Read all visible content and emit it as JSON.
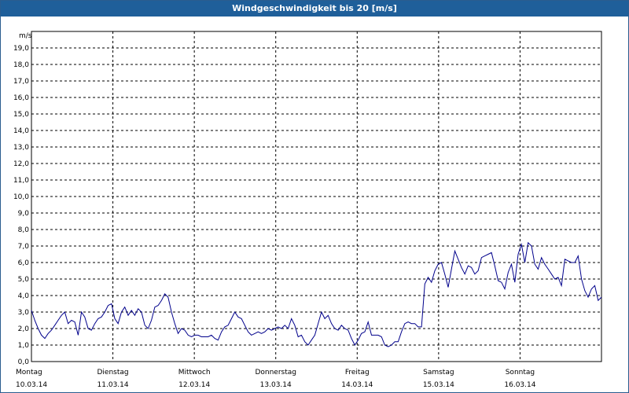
{
  "window": {
    "title": "Windgeschwindigkeit bis 20 [m/s]"
  },
  "colors": {
    "title_bar": "#1f5f9a",
    "line": "#00008b",
    "grid": "#000000",
    "background": "#ffffff"
  },
  "chart_data": {
    "type": "line",
    "title": "Windgeschwindigkeit bis 20 [m/s]",
    "ylabel": "m/s",
    "xlabel": "",
    "ylim": [
      0,
      20
    ],
    "yticks": [
      "0,0",
      "1,0",
      "2,0",
      "3,0",
      "4,0",
      "5,0",
      "6,0",
      "7,0",
      "8,0",
      "9,0",
      "10,0",
      "11,0",
      "12,0",
      "13,0",
      "14,0",
      "15,0",
      "16,0",
      "17,0",
      "18,0",
      "19,0"
    ],
    "xlim": [
      0,
      7
    ],
    "xticks": [
      {
        "day": "Montag",
        "date": "10.03.14"
      },
      {
        "day": "Dienstag",
        "date": "11.03.14"
      },
      {
        "day": "Mittwoch",
        "date": "12.03.14"
      },
      {
        "day": "Donnerstag",
        "date": "13.03.14"
      },
      {
        "day": "Freitag",
        "date": "14.03.14"
      },
      {
        "day": "Samstag",
        "date": "15.03.14"
      },
      {
        "day": "Sonntag",
        "date": "16.03.14"
      }
    ],
    "grid": true,
    "series": [
      {
        "values": [
          3.1,
          2.5,
          2.0,
          1.6,
          1.4,
          1.7,
          1.9,
          2.2,
          2.5,
          2.8,
          3.0,
          2.3,
          2.5,
          2.4,
          1.6,
          3.0,
          2.7,
          2.0,
          1.9,
          2.3,
          2.6,
          2.7,
          3.0,
          3.4,
          3.5,
          2.6,
          2.3,
          3.0,
          3.3,
          2.8,
          3.1,
          2.8,
          3.2,
          3.0,
          2.2,
          2.0,
          2.5,
          3.3,
          3.4,
          3.7,
          4.1,
          3.9,
          3.0,
          2.3,
          1.7,
          2.0,
          1.9,
          1.6,
          1.5,
          1.6,
          1.6,
          1.5,
          1.5,
          1.5,
          1.6,
          1.4,
          1.3,
          1.8,
          2.1,
          2.2,
          2.6,
          3.0,
          2.7,
          2.6,
          2.2,
          1.8,
          1.6,
          1.7,
          1.8,
          1.7,
          1.8,
          2.0,
          1.9,
          2.0,
          2.1,
          2.0,
          2.2,
          2.0,
          2.6,
          2.2,
          1.5,
          1.6,
          1.2,
          1.0,
          1.3,
          1.6,
          2.3,
          3.0,
          2.6,
          2.8,
          2.3,
          2.0,
          1.9,
          2.2,
          2.0,
          1.9,
          1.4,
          1.0,
          1.3,
          1.7,
          1.8,
          2.4,
          1.6,
          1.6,
          1.6,
          1.5,
          1.0,
          0.9,
          1.0,
          1.2,
          1.2,
          1.8,
          2.3,
          2.4,
          2.3,
          2.3,
          2.1,
          2.1,
          4.7,
          5.1,
          4.8,
          5.5,
          5.9,
          6.0,
          5.3,
          4.5,
          5.6,
          6.7,
          6.2,
          5.7,
          5.3,
          5.8,
          5.7,
          5.3,
          5.5,
          6.3,
          6.4,
          6.5,
          6.6,
          5.8,
          4.9,
          4.8,
          4.4,
          5.4,
          5.9,
          4.8,
          6.5,
          7.1,
          6.0,
          7.2,
          7.0,
          5.9,
          5.6,
          6.3,
          5.9,
          5.6,
          5.3,
          5.0,
          5.1,
          4.6,
          6.2,
          6.1,
          6.0,
          6.0,
          6.4,
          5.0,
          4.3,
          3.9,
          4.4,
          4.6,
          3.7,
          3.9
        ]
      }
    ]
  }
}
